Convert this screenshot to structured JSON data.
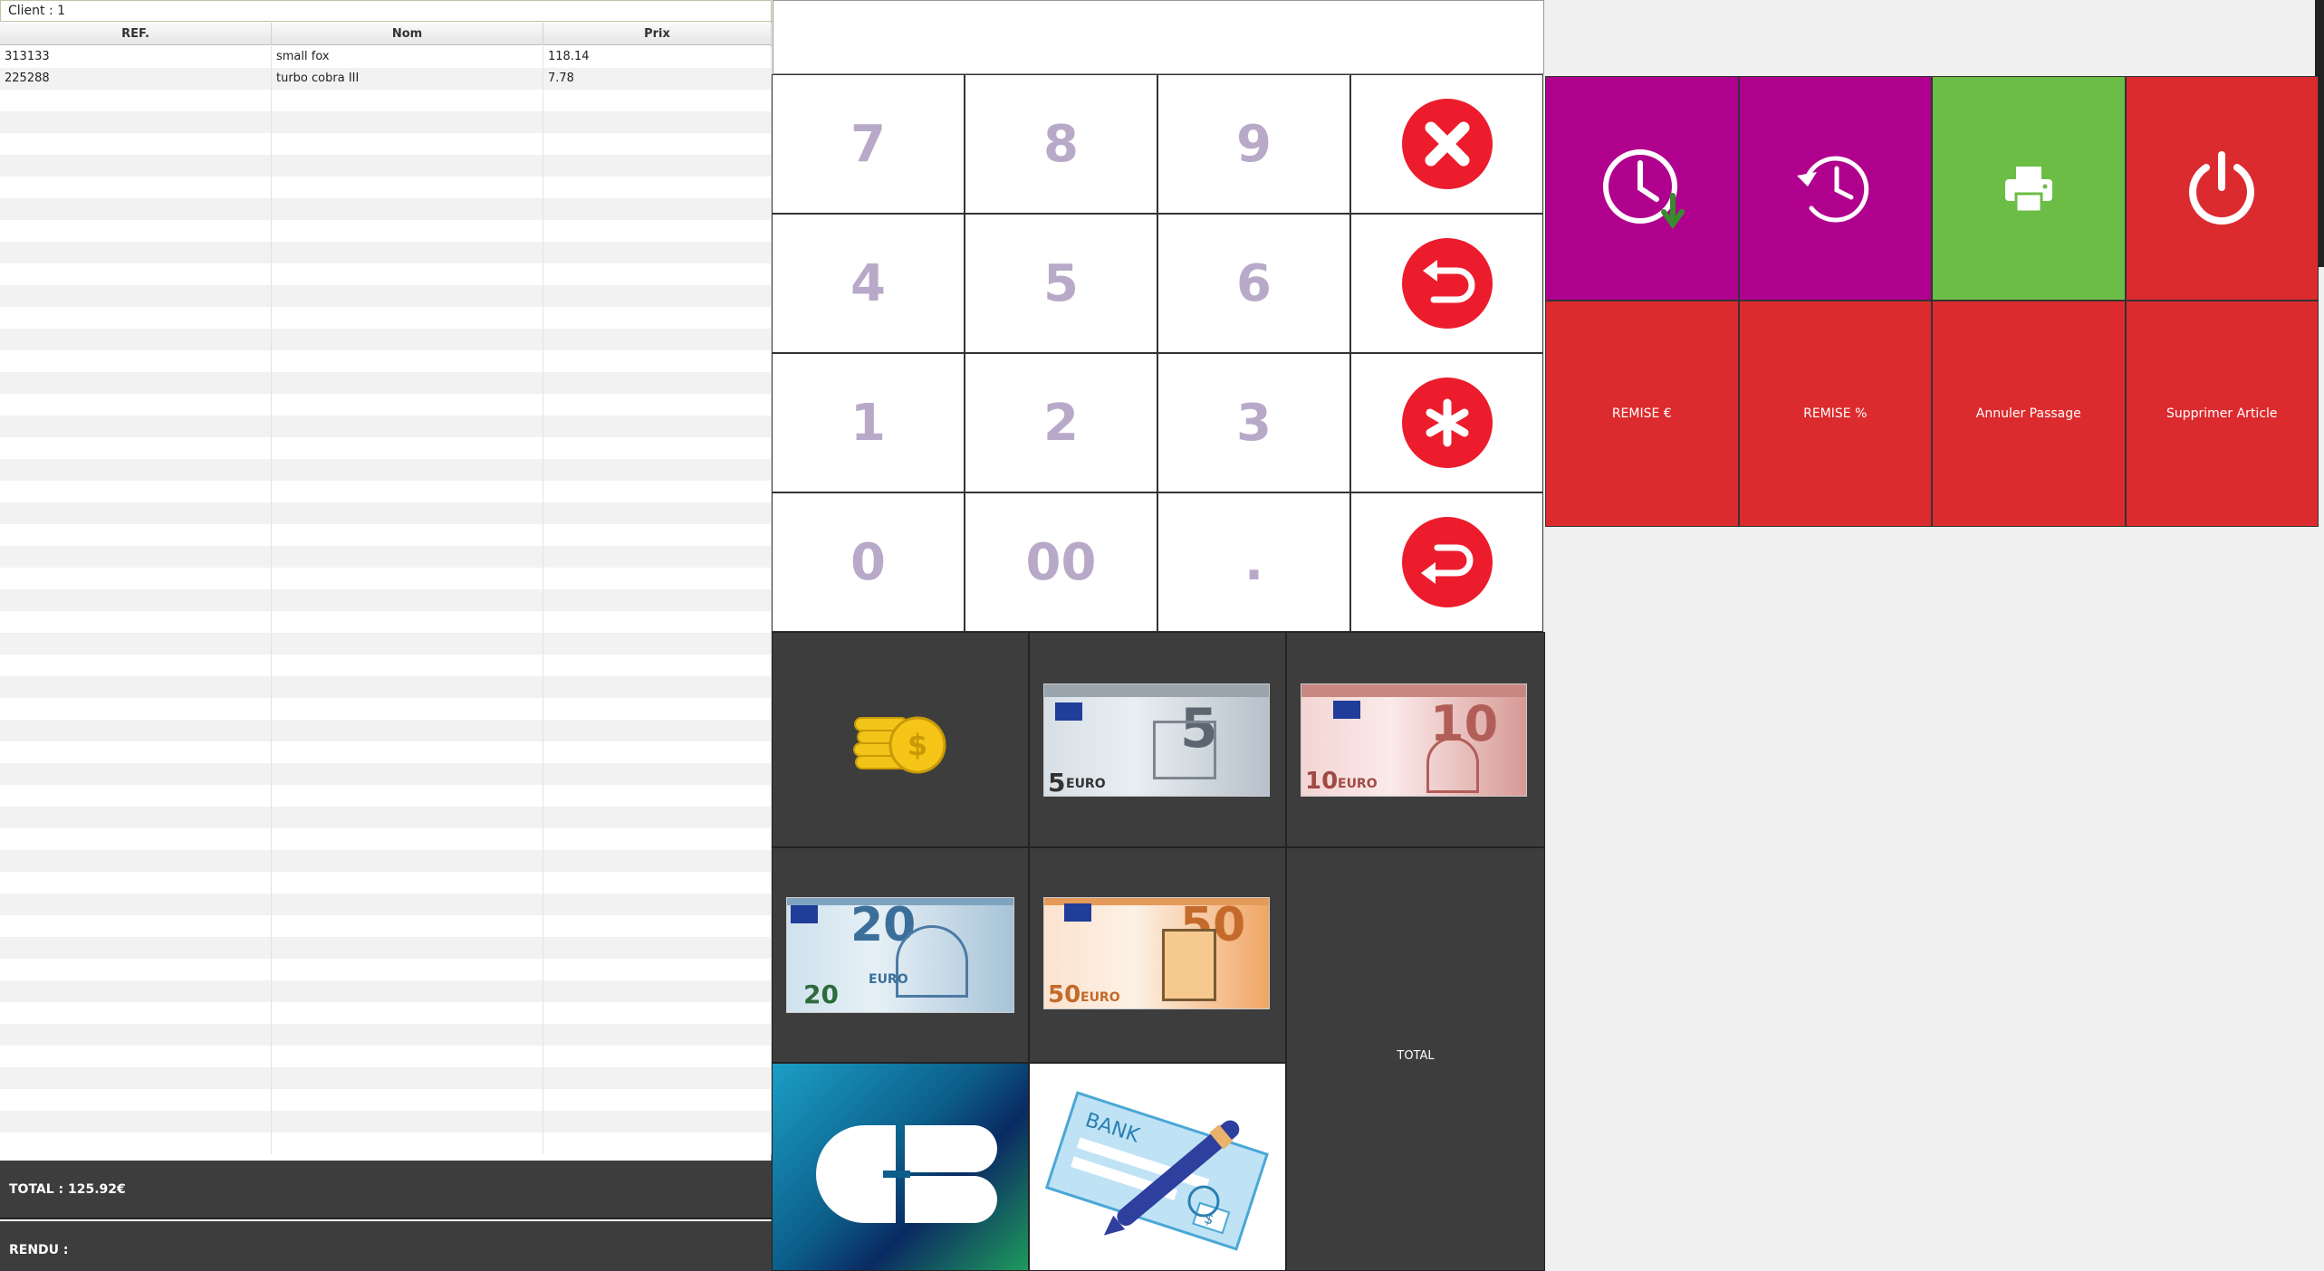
{
  "client": {
    "label": "Client : 1"
  },
  "table": {
    "headers": [
      "REF.",
      "Nom",
      "Prix"
    ],
    "rows": [
      [
        "313133",
        "small fox",
        "118.14"
      ],
      [
        "225288",
        "turbo cobra III",
        "7.78"
      ]
    ]
  },
  "totals": {
    "total_label": "TOTAL : 125.92€",
    "rendu_label": "RENDU :"
  },
  "keypad": {
    "keys": [
      "7",
      "8",
      "9",
      "4",
      "5",
      "6",
      "1",
      "2",
      "3",
      "0",
      "00",
      "."
    ],
    "icons": [
      "cancel-x-icon",
      "backspace-icon",
      "multiply-asterisk-icon",
      "enter-return-icon"
    ]
  },
  "payment": {
    "tiles": [
      "coins-icon",
      "5-euro-note",
      "10-euro-note",
      "20-euro-note",
      "50-euro-note",
      "cb-card-icon",
      "bank-check-icon"
    ],
    "note_numbers": [
      "5",
      "10",
      "20",
      "50"
    ],
    "note_currency": "EURO",
    "cb_text": "CB",
    "check_text": "BANK",
    "check_symbol": "$",
    "coin_symbol": "$",
    "total_label": "TOTAL"
  },
  "functions": {
    "icons": [
      "clock-forward-icon",
      "history-icon",
      "printer-icon",
      "power-icon"
    ],
    "buttons": [
      "REMISE €",
      "REMISE %",
      "Annuler Passage",
      "Supprimer Article"
    ]
  },
  "colors": {
    "purple": "#b0008e",
    "green": "#6cbd45",
    "red": "#dc2b2e",
    "dark": "#3d3d3d",
    "key_text": "#b9a9c9",
    "circle_red": "#ec1c2d"
  }
}
